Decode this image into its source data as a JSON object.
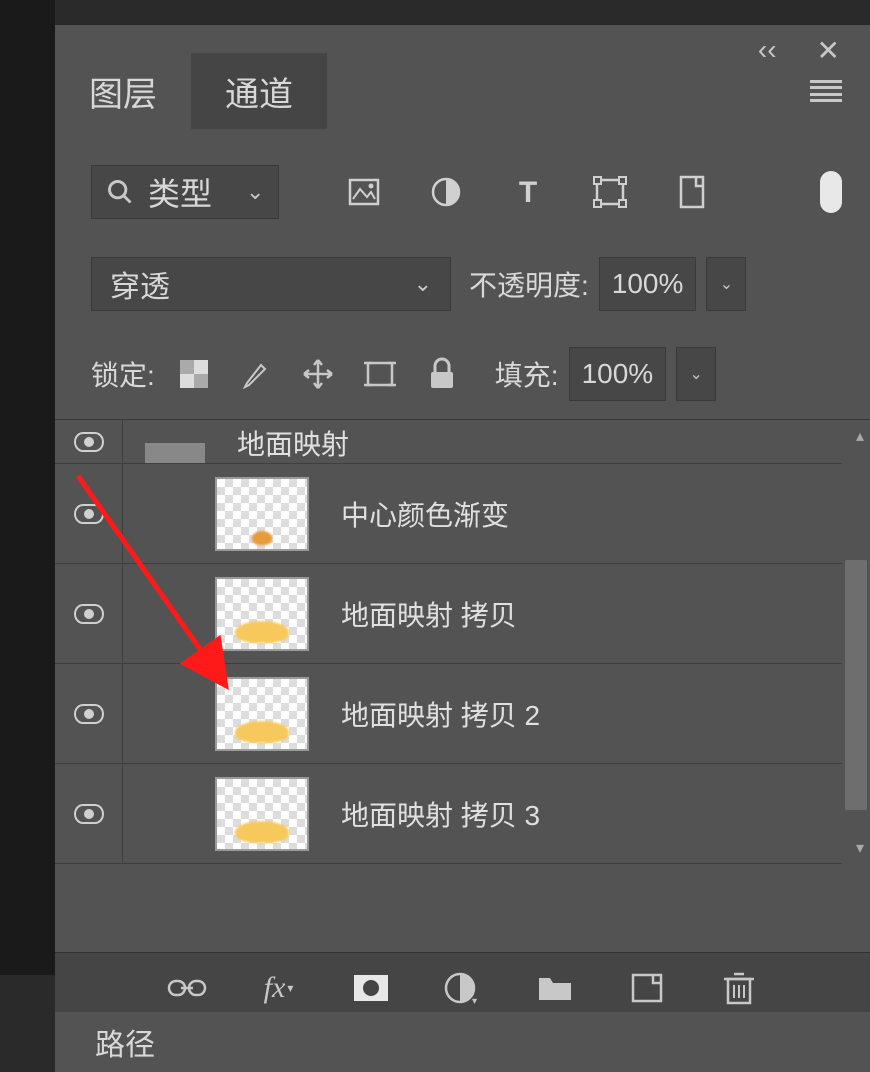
{
  "titlebar": {
    "collapse": "‹‹",
    "close": "✕"
  },
  "tabs": {
    "layers": "图层",
    "channels": "通道",
    "paths": "路径"
  },
  "filter": {
    "search_label": "类型"
  },
  "blend": {
    "mode": "穿透",
    "opacity_label": "不透明度:",
    "opacity_value": "100%"
  },
  "lock": {
    "label": "锁定:",
    "fill_label": "填充:",
    "fill_value": "100%"
  },
  "layers": [
    {
      "name": "地面映射",
      "clipped": true
    },
    {
      "name": "中心颜色渐变",
      "blob": "small"
    },
    {
      "name": "地面映射 拷贝",
      "blob": "big"
    },
    {
      "name": "地面映射 拷贝 2",
      "blob": "big"
    },
    {
      "name": "地面映射 拷贝 3",
      "blob": "big"
    }
  ]
}
